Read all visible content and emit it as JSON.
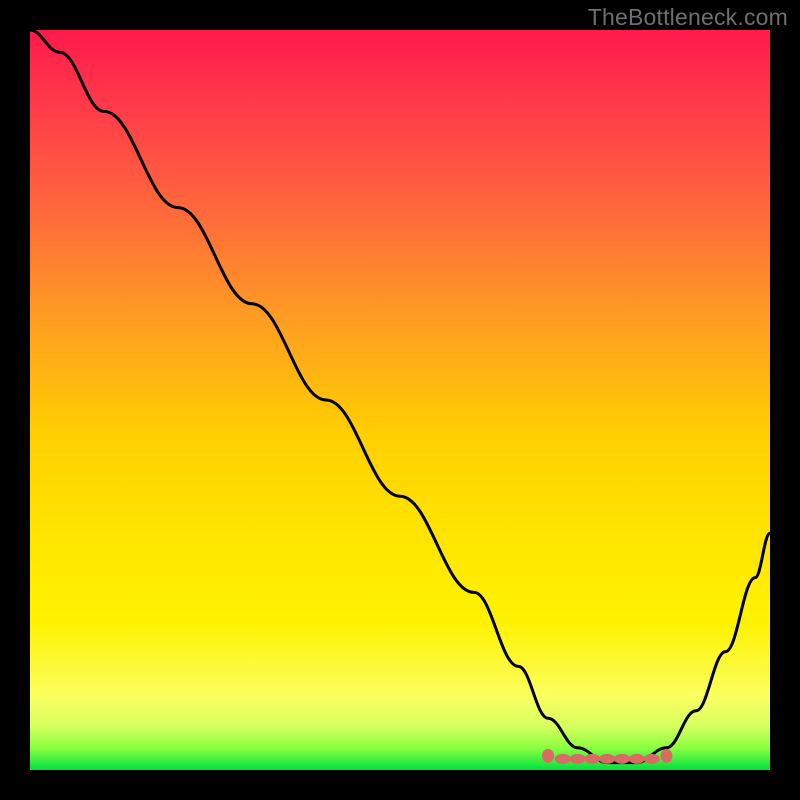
{
  "watermark": "TheBottleneck.com",
  "chart_data": {
    "type": "line",
    "title": "",
    "xlabel": "",
    "ylabel": "",
    "xlim": [
      0,
      100
    ],
    "ylim": [
      0,
      100
    ],
    "series": [
      {
        "name": "curve",
        "x": [
          0,
          4,
          10,
          20,
          30,
          40,
          50,
          60,
          66,
          70,
          74,
          78,
          82,
          86,
          90,
          94,
          98,
          100
        ],
        "values": [
          100,
          97,
          89,
          76,
          63,
          50,
          37,
          24,
          14,
          7,
          3,
          1,
          1,
          3,
          8,
          16,
          26,
          32
        ]
      }
    ],
    "sweet_spot": {
      "x_start": 70,
      "x_end": 86,
      "y": 1.5
    }
  },
  "colors": {
    "curve": "#000000",
    "marker_fill": "#d96a64",
    "marker_stroke": "#6b3030"
  }
}
